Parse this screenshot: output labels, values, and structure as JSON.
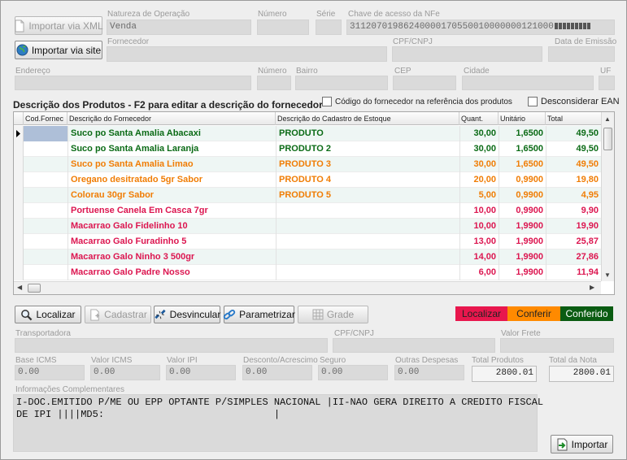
{
  "header": {
    "btn_import_xml": "Importar via XML",
    "btn_import_site": "Importar via site",
    "natureza_label": "Natureza de Operação",
    "natureza_value": "Venda",
    "numero_label": "Número",
    "serie_label": "Série",
    "chave_label": "Chave de acesso da NFe",
    "chave_value": "31120701986240000170550010000000121000",
    "fornecedor_label": "Fornecedor",
    "cnpj_label": "CPF/CNPJ",
    "emissao_label": "Data de Emissão",
    "endereco_label": "Endereço",
    "numero2_label": "Número",
    "bairro_label": "Bairro",
    "cep_label": "CEP",
    "cidade_label": "Cidade",
    "uf_label": "UF"
  },
  "products": {
    "section_title": "Descrição dos Produtos - F2 para editar a descrição do fornecedor",
    "chk_codigo": "Código do fornecedor na referência dos produtos",
    "chk_ean": "Desconsiderar EAN",
    "columns": [
      "Cod.Fornec",
      "Descrição do Fornecedor",
      "Descrição do Cadastro de Estoque",
      "Quant.",
      "Unitário",
      "Total"
    ],
    "rows": [
      {
        "cod": "",
        "desc": "Suco po Santa Amalia Abacaxi",
        "estoque": "PRODUTO",
        "qtd": "30,00",
        "unit": "1,6500",
        "total": "49,50",
        "status": "green"
      },
      {
        "cod": "",
        "desc": "Suco po Santa Amalia Laranja",
        "estoque": "PRODUTO 2",
        "qtd": "30,00",
        "unit": "1,6500",
        "total": "49,50",
        "status": "green"
      },
      {
        "cod": "",
        "desc": "Suco po Santa Amalia Limao",
        "estoque": "PRODUTO 3",
        "qtd": "30,00",
        "unit": "1,6500",
        "total": "49,50",
        "status": "orange"
      },
      {
        "cod": "",
        "desc": "Oregano desitratado 5gr Sabor",
        "estoque": "PRODUTO 4",
        "qtd": "20,00",
        "unit": "0,9900",
        "total": "19,80",
        "status": "orange"
      },
      {
        "cod": "",
        "desc": "Colorau 30gr Sabor",
        "estoque": "PRODUTO 5",
        "qtd": "5,00",
        "unit": "0,9900",
        "total": "4,95",
        "status": "orange"
      },
      {
        "cod": "",
        "desc": "Portuense Canela Em Casca 7gr",
        "estoque": "",
        "qtd": "10,00",
        "unit": "0,9900",
        "total": "9,90",
        "status": "red"
      },
      {
        "cod": "",
        "desc": "Macarrao Galo Fidelinho 10",
        "estoque": "",
        "qtd": "10,00",
        "unit": "1,9900",
        "total": "19,90",
        "status": "red"
      },
      {
        "cod": "",
        "desc": "Macarrao Galo Furadinho 5",
        "estoque": "",
        "qtd": "13,00",
        "unit": "1,9900",
        "total": "25,87",
        "status": "red"
      },
      {
        "cod": "",
        "desc": "Macarrao Galo Ninho 3 500gr",
        "estoque": "",
        "qtd": "14,00",
        "unit": "1,9900",
        "total": "27,86",
        "status": "red"
      },
      {
        "cod": "",
        "desc": "Macarrao Galo Padre Nosso",
        "estoque": "",
        "qtd": "6,00",
        "unit": "1,9900",
        "total": "11,94",
        "status": "red"
      }
    ]
  },
  "toolbar": {
    "localizar": "Localizar",
    "cadastrar": "Cadastrar",
    "desvincular": "Desvincular",
    "parametrizar": "Parametrizar",
    "grade": "Grade"
  },
  "legend": {
    "localizar": "Localizar",
    "conferir": "Conferir",
    "conferido": "Conferido"
  },
  "totals": {
    "transportadora_label": "Transportadora",
    "cnpj_label": "CPF/CNPJ",
    "frete_label": "Valor Frete",
    "base_icms_label": "Base ICMS",
    "base_icms": "0.00",
    "valor_icms_label": "Valor ICMS",
    "valor_icms": "0.00",
    "valor_ipi_label": "Valor IPI",
    "valor_ipi": "0.00",
    "desconto_label": "Desconto/Acrescimo",
    "desconto": "0.00",
    "seguro_label": "Seguro",
    "seguro": "0.00",
    "outras_label": "Outras Despesas",
    "outras": "0.00",
    "total_produtos_label": "Total Produtos",
    "total_produtos": "2800.01",
    "total_nota_label": "Total da Nota",
    "total_nota": "2800.01"
  },
  "info": {
    "label": "Informações Complementares",
    "text": "I-DOC.EMITIDO P/ME OU EPP OPTANTE P/SIMPLES NACIONAL |II-NAO GERA DIREITO A CREDITO FISCAL\nDE IPI ||||MD5:                             |"
  },
  "footer": {
    "importar": "Importar"
  },
  "colors": {
    "green": "#0b6b16",
    "orange": "#f07d05",
    "red": "#dc1650",
    "legend_red": "#e8174d",
    "legend_orange": "#ff8a00",
    "legend_green": "#0a5c12"
  }
}
